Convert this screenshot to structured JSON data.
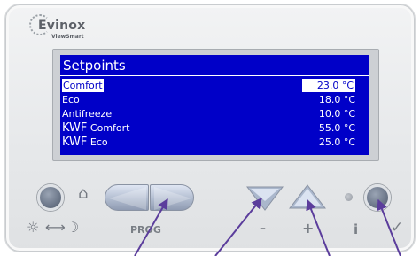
{
  "brand": {
    "name": "Evinox",
    "subname": "ViewSmart"
  },
  "lcd": {
    "title": "Setpoints",
    "rows": [
      {
        "label": "Comfort",
        "label_small": "",
        "value": "23.0 °C",
        "selected": true
      },
      {
        "label": "Eco",
        "label_small": "",
        "value": "18.0 °C",
        "selected": false
      },
      {
        "label": "Antifreeze",
        "label_small": "",
        "value": "10.0 °C",
        "selected": false
      },
      {
        "label": "KWF",
        "label_small": "Comfort",
        "value": "55.0 °C",
        "selected": false
      },
      {
        "label": "KWF",
        "label_small": "Eco",
        "value": "25.0 °C",
        "selected": false
      }
    ]
  },
  "controls": {
    "prog_label": "PROG",
    "minus_label": "–",
    "plus_label": "+",
    "info_label": "i",
    "check_label": "✓",
    "home_icon": "⌂",
    "sun_icon": "☼",
    "arrow_icon": "⟷",
    "moon_icon": "☽"
  },
  "colors": {
    "lcd_background": "#0000c8",
    "lcd_text": "#ffffff",
    "button_blue": "#b5c0d3",
    "pointer": "#5b3d9c"
  }
}
